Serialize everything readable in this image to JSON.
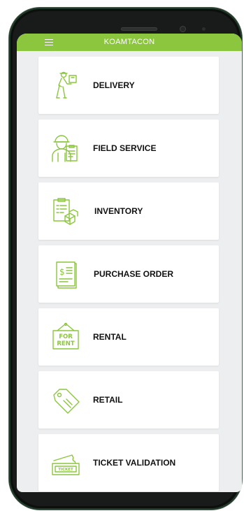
{
  "app": {
    "title": "KOAMTACON"
  },
  "icons": {
    "menu": "hamburger-menu-icon",
    "accent": "#8cc63f"
  },
  "menu_items": [
    {
      "label": "DELIVERY",
      "icon": "delivery-person-icon"
    },
    {
      "label": "FIELD SERVICE",
      "icon": "field-technician-icon"
    },
    {
      "label": "INVENTORY",
      "icon": "inventory-clipboard-boxes-icon"
    },
    {
      "label": "PURCHASE ORDER",
      "icon": "purchase-order-document-icon"
    },
    {
      "label": "RENTAL",
      "icon": "for-rent-sign-icon"
    },
    {
      "label": "RETAIL",
      "icon": "price-tag-icon"
    },
    {
      "label": "TICKET VALIDATION",
      "icon": "ticket-icon"
    }
  ],
  "rent_sign": {
    "line1": "FOR",
    "line2": "RENT"
  },
  "ticket_text": "TICKET"
}
